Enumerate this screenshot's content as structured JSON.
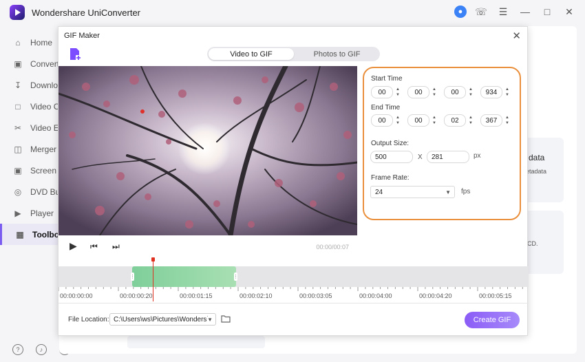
{
  "app": {
    "title": "Wondershare UniConverter"
  },
  "sidebar": {
    "items": [
      {
        "label": "Home",
        "icon": "home-icon"
      },
      {
        "label": "Converter",
        "icon": "converter-icon"
      },
      {
        "label": "Downloader",
        "icon": "download-icon"
      },
      {
        "label": "Video Compressor",
        "icon": "compress-icon"
      },
      {
        "label": "Video Editor",
        "icon": "scissors-icon"
      },
      {
        "label": "Merger",
        "icon": "merger-icon"
      },
      {
        "label": "Screen Recorder",
        "icon": "screen-recorder-icon"
      },
      {
        "label": "DVD Burner",
        "icon": "dvd-icon"
      },
      {
        "label": "Player",
        "icon": "player-icon"
      },
      {
        "label": "Toolbox",
        "icon": "toolbox-icon"
      }
    ],
    "active": "Toolbox"
  },
  "background": {
    "card1_title": "data",
    "card1_sub": "etadata",
    "card2_sub": "CD."
  },
  "dialog": {
    "title": "GIF Maker",
    "tabs": [
      "Video to GIF",
      "Photos to GIF"
    ],
    "active_tab": "Video to GIF",
    "player": {
      "time": "00:00/00:07"
    },
    "start_time": {
      "label": "Start Time",
      "h": "00",
      "m": "00",
      "s": "00",
      "ms": "934"
    },
    "end_time": {
      "label": "End Time",
      "h": "00",
      "m": "00",
      "s": "02",
      "ms": "367"
    },
    "output_size": {
      "label": "Output Size:",
      "width": "500",
      "sep": "X",
      "height": "281",
      "unit": "px"
    },
    "frame_rate": {
      "label": "Frame Rate:",
      "value": "24",
      "unit": "fps"
    },
    "timeline_ticks": [
      "00:00:00:00",
      "00:00:00:20",
      "00:00:01:15",
      "00:00:02:10",
      "00:00:03:05",
      "00:00:04:00",
      "00:00:04:20",
      "00:00:05:15"
    ],
    "file_location": {
      "label": "File Location:",
      "value": "C:\\Users\\ws\\Pictures\\Wondersh"
    },
    "create_button": "Create GIF"
  },
  "colors": {
    "accent": "#8b5cf6",
    "highlight_border": "#ea8f3c",
    "selection": "#8fd6a5",
    "playhead": "#e0301f"
  }
}
